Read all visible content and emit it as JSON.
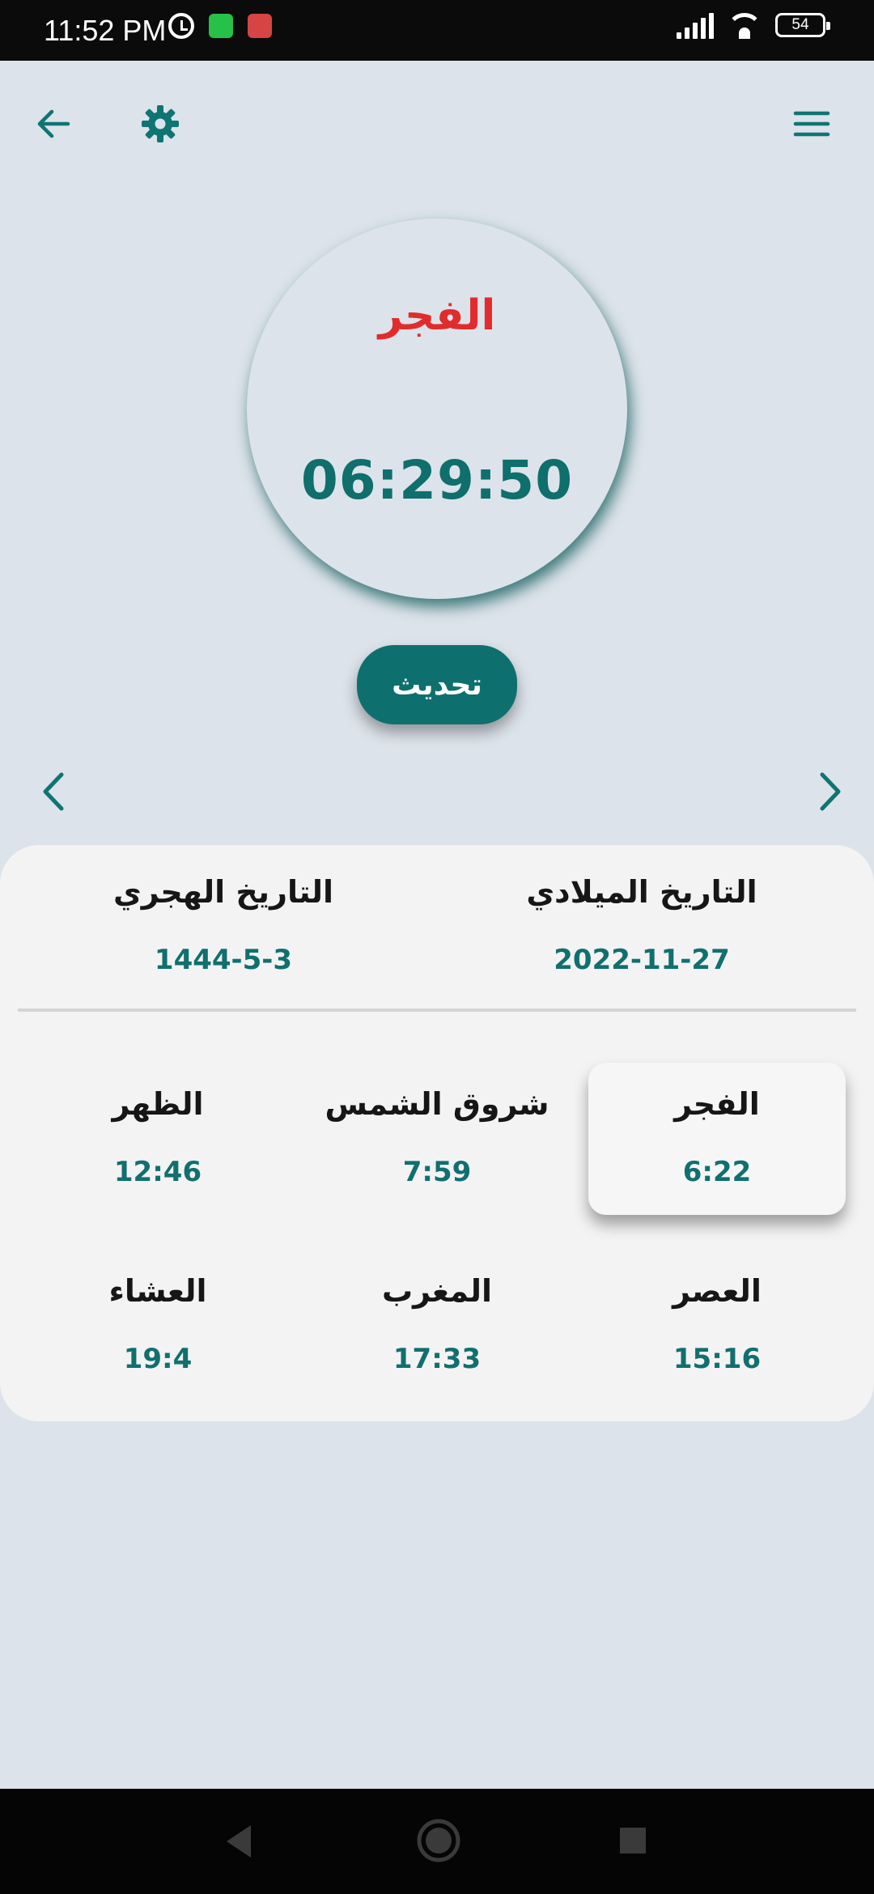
{
  "status_bar": {
    "time": "11:52 PM",
    "battery": "54",
    "icons": [
      "alarm-icon",
      "whatsapp-icon",
      "volume-icon",
      "signal-icon",
      "wifi-icon",
      "battery-icon"
    ]
  },
  "toolbar": {
    "icons": [
      "back-arrow-icon",
      "gear-icon",
      "menu-icon"
    ]
  },
  "next_prayer": {
    "name": "الفجر",
    "countdown": "06:29:50"
  },
  "update_button": "تحديث",
  "dates": {
    "hijri_label": "التاريخ الهجري",
    "hijri_value": "1444-5-3",
    "gregorian_label": "التاريخ الميلادي",
    "gregorian_value": "2022-11-27"
  },
  "prayers": [
    {
      "name": "الفجر",
      "time": "6:22"
    },
    {
      "name": "شروق الشمس",
      "time": "7:59"
    },
    {
      "name": "الظهر",
      "time": "12:46"
    },
    {
      "name": "العصر",
      "time": "15:16"
    },
    {
      "name": "المغرب",
      "time": "17:33"
    },
    {
      "name": "العشاء",
      "time": "19:4"
    }
  ],
  "highlighted_prayer": "الفجر",
  "colors": {
    "background": "#dce3ea",
    "accent": "#0e706e",
    "next_prayer_name": "#e02c2c",
    "card": "#f3f3f3"
  }
}
